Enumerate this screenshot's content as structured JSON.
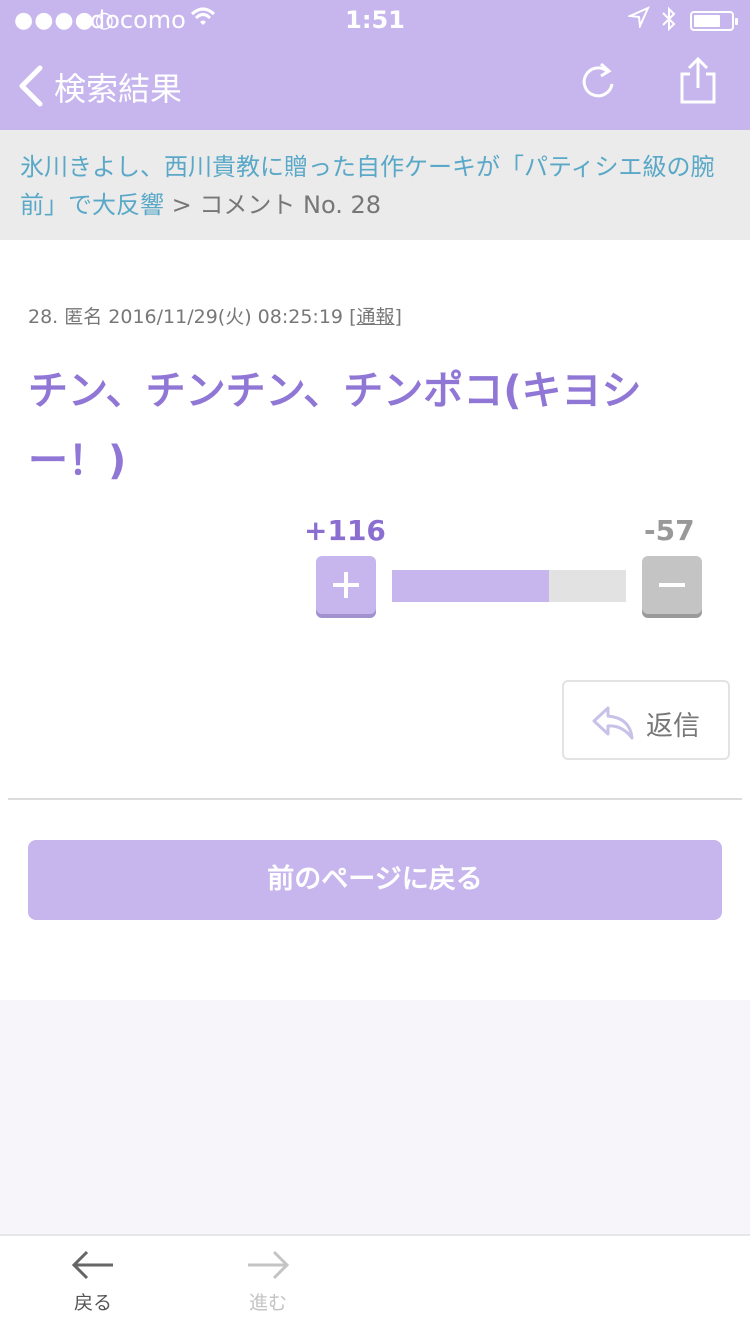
{
  "status_bar": {
    "signal": "●●●●○",
    "carrier": "docomo",
    "time": "1:51"
  },
  "nav": {
    "title": "検索結果",
    "icons": [
      "chevron-left-icon",
      "reload-icon",
      "share-icon"
    ]
  },
  "breadcrumb": {
    "article": "氷川きよし、西川貴教に贈った自作ケーキが「パティシエ級の腕前」で大反響",
    "separator": ">",
    "current": "コメント No. 28"
  },
  "comment": {
    "meta": "28. 匿名 2016/11/29(火) 08:25:19",
    "report_label": "通報",
    "body": "チン、チンチン、チンポコ(キヨシー！)"
  },
  "votes": {
    "plus_label": "+116",
    "minus_label": "-57",
    "plus_ratio": 0.67
  },
  "reply": {
    "label": "返信",
    "icon": "reply-icon"
  },
  "back_page_label": "前のページに戻る",
  "toolbar": {
    "back_label": "戻る",
    "forward_label": "進む"
  },
  "colors": {
    "accent": "#c7b6ee",
    "comment_text": "#9077d5",
    "link": "#5aa8c7",
    "minus": "#c4c4c4"
  }
}
